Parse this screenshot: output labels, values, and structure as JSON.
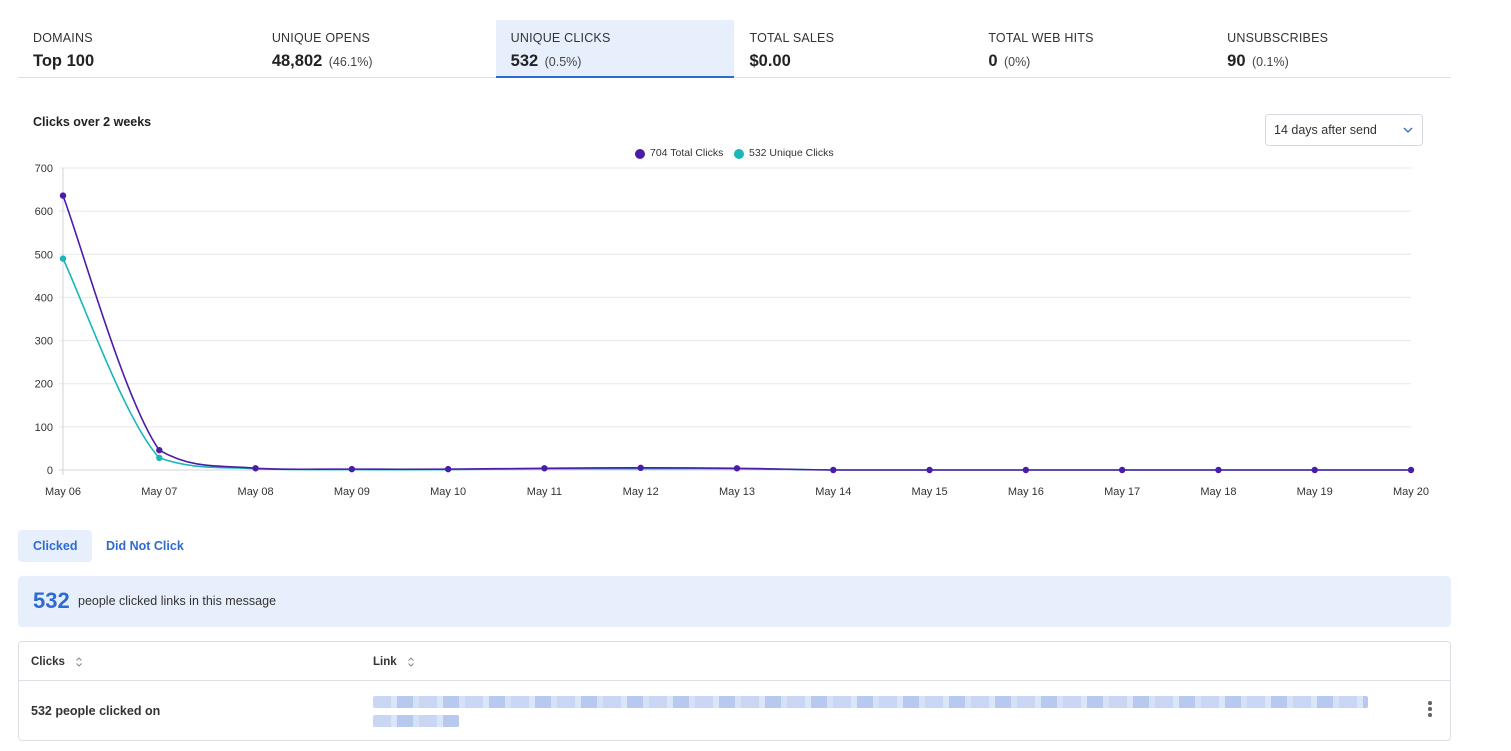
{
  "stats": [
    {
      "label": "DOMAINS",
      "value": "Top 100",
      "pct": ""
    },
    {
      "label": "UNIQUE OPENS",
      "value": "48,802",
      "pct": "(46.1%)"
    },
    {
      "label": "UNIQUE CLICKS",
      "value": "532",
      "pct": "(0.5%)"
    },
    {
      "label": "TOTAL SALES",
      "value": "$0.00",
      "pct": ""
    },
    {
      "label": "TOTAL WEB HITS",
      "value": "0",
      "pct": "(0%)"
    },
    {
      "label": "UNSUBSCRIBES",
      "value": "90",
      "pct": "(0.1%)"
    }
  ],
  "active_stat": "UNIQUE CLICKS",
  "chart_title": "Clicks over 2 weeks",
  "range_select": {
    "value": "14 days after send",
    "icon": "chevron-down-icon"
  },
  "chart_data": {
    "type": "line",
    "title": "Clicks over 2 weeks",
    "x": [
      "May 06",
      "May 07",
      "May 08",
      "May 09",
      "May 10",
      "May 11",
      "May 12",
      "May 13",
      "May 14",
      "May 15",
      "May 16",
      "May 17",
      "May 18",
      "May 19",
      "May 20"
    ],
    "series": [
      {
        "name": "704 Total Clicks",
        "color": "#4a1ca8",
        "values": [
          636,
          46,
          4,
          2,
          2,
          4,
          5,
          4,
          0,
          0,
          0,
          0,
          0,
          0,
          0
        ]
      },
      {
        "name": "532 Unique Clicks",
        "color": "#1ab6b8",
        "values": [
          490,
          28,
          3,
          1,
          1,
          3,
          3,
          3,
          0,
          0,
          0,
          0,
          0,
          0,
          0
        ]
      }
    ],
    "yticks": [
      0,
      100,
      200,
      300,
      400,
      500,
      600,
      700
    ],
    "ylim": [
      0,
      700
    ],
    "grid": true,
    "legend": "top-center"
  },
  "tabs": {
    "clicked": "Clicked",
    "not_clicked": "Did Not Click"
  },
  "summary": {
    "count": "532",
    "text": "people clicked links in this message"
  },
  "table": {
    "headers": {
      "clicks": "Clicks",
      "link": "Link"
    },
    "rows": [
      {
        "clicks": "532 people clicked on"
      }
    ]
  }
}
